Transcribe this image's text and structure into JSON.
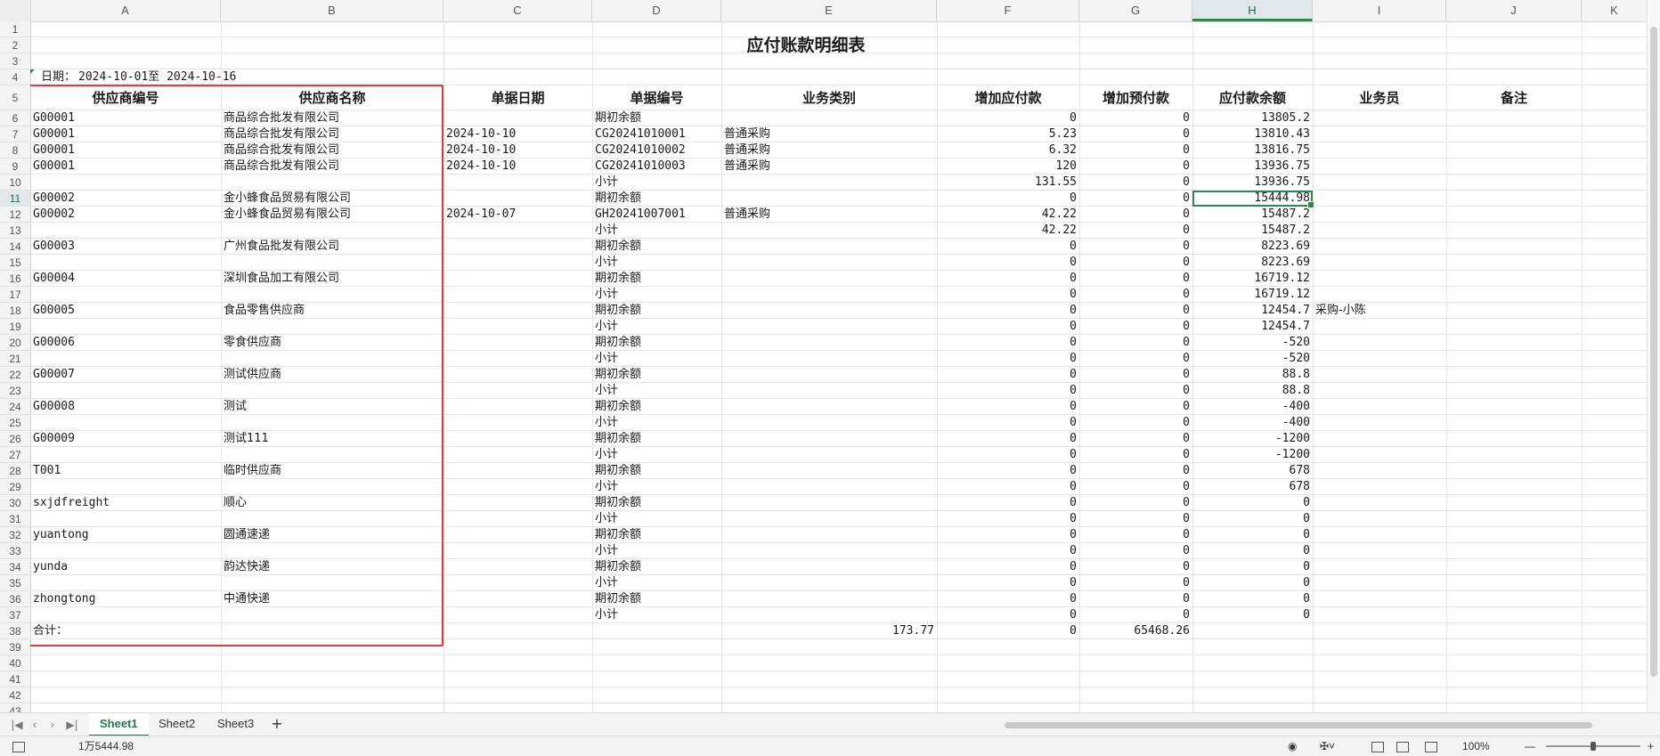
{
  "columns": [
    "A",
    "B",
    "C",
    "D",
    "E",
    "F",
    "G",
    "H",
    "I",
    "J",
    "K"
  ],
  "selected_column": "H",
  "selected_row": 11,
  "rows_count": 43,
  "title": "应付账款明细表",
  "date_label": "日期：",
  "date_range": "2024-10-01至 2024-10-16",
  "headers": [
    "供应商编号",
    "供应商名称",
    "单据日期",
    "单据编号",
    "业务类别",
    "增加应付款",
    "增加预付款",
    "应付款余额",
    "业务员",
    "备注"
  ],
  "table_rows": [
    {
      "row": 6,
      "A": "G00001",
      "B": "商品综合批发有限公司",
      "C": "",
      "D": "期初余额",
      "E": "",
      "F": "0",
      "G": "0",
      "H": "13805.2",
      "I": ""
    },
    {
      "row": 7,
      "A": "G00001",
      "B": "商品综合批发有限公司",
      "C": "2024-10-10",
      "D": "CG20241010001",
      "E": "普通采购",
      "F": "5.23",
      "G": "0",
      "H": "13810.43",
      "I": ""
    },
    {
      "row": 8,
      "A": "G00001",
      "B": "商品综合批发有限公司",
      "C": "2024-10-10",
      "D": "CG20241010002",
      "E": "普通采购",
      "F": "6.32",
      "G": "0",
      "H": "13816.75",
      "I": ""
    },
    {
      "row": 9,
      "A": "G00001",
      "B": "商品综合批发有限公司",
      "C": "2024-10-10",
      "D": "CG20241010003",
      "E": "普通采购",
      "F": "120",
      "G": "0",
      "H": "13936.75",
      "I": ""
    },
    {
      "row": 10,
      "A": "",
      "B": "",
      "C": "",
      "D": "小计",
      "E": "",
      "F": "131.55",
      "G": "0",
      "H": "13936.75",
      "I": ""
    },
    {
      "row": 11,
      "A": "G00002",
      "B": "金小蜂食品贸易有限公司",
      "C": "",
      "D": "期初余额",
      "E": "",
      "F": "0",
      "G": "0",
      "H": "15444.98",
      "I": ""
    },
    {
      "row": 12,
      "A": "G00002",
      "B": "金小蜂食品贸易有限公司",
      "C": "2024-10-07",
      "D": "GH20241007001",
      "E": "普通采购",
      "F": "42.22",
      "G": "0",
      "H": "15487.2",
      "I": ""
    },
    {
      "row": 13,
      "A": "",
      "B": "",
      "C": "",
      "D": "小计",
      "E": "",
      "F": "42.22",
      "G": "0",
      "H": "15487.2",
      "I": ""
    },
    {
      "row": 14,
      "A": "G00003",
      "B": "广州食品批发有限公司",
      "C": "",
      "D": "期初余额",
      "E": "",
      "F": "0",
      "G": "0",
      "H": "8223.69",
      "I": ""
    },
    {
      "row": 15,
      "A": "",
      "B": "",
      "C": "",
      "D": "小计",
      "E": "",
      "F": "0",
      "G": "0",
      "H": "8223.69",
      "I": ""
    },
    {
      "row": 16,
      "A": "G00004",
      "B": "深圳食品加工有限公司",
      "C": "",
      "D": "期初余额",
      "E": "",
      "F": "0",
      "G": "0",
      "H": "16719.12",
      "I": ""
    },
    {
      "row": 17,
      "A": "",
      "B": "",
      "C": "",
      "D": "小计",
      "E": "",
      "F": "0",
      "G": "0",
      "H": "16719.12",
      "I": ""
    },
    {
      "row": 18,
      "A": "G00005",
      "B": "食品零售供应商",
      "C": "",
      "D": "期初余额",
      "E": "",
      "F": "0",
      "G": "0",
      "H": "12454.7",
      "I": "采购-小陈"
    },
    {
      "row": 19,
      "A": "",
      "B": "",
      "C": "",
      "D": "小计",
      "E": "",
      "F": "0",
      "G": "0",
      "H": "12454.7",
      "I": ""
    },
    {
      "row": 20,
      "A": "G00006",
      "B": "零食供应商",
      "C": "",
      "D": "期初余额",
      "E": "",
      "F": "0",
      "G": "0",
      "H": "-520",
      "I": ""
    },
    {
      "row": 21,
      "A": "",
      "B": "",
      "C": "",
      "D": "小计",
      "E": "",
      "F": "0",
      "G": "0",
      "H": "-520",
      "I": ""
    },
    {
      "row": 22,
      "A": "G00007",
      "B": "测试供应商",
      "C": "",
      "D": "期初余额",
      "E": "",
      "F": "0",
      "G": "0",
      "H": "88.8",
      "I": ""
    },
    {
      "row": 23,
      "A": "",
      "B": "",
      "C": "",
      "D": "小计",
      "E": "",
      "F": "0",
      "G": "0",
      "H": "88.8",
      "I": ""
    },
    {
      "row": 24,
      "A": "G00008",
      "B": "测试",
      "C": "",
      "D": "期初余额",
      "E": "",
      "F": "0",
      "G": "0",
      "H": "-400",
      "I": ""
    },
    {
      "row": 25,
      "A": "",
      "B": "",
      "C": "",
      "D": "小计",
      "E": "",
      "F": "0",
      "G": "0",
      "H": "-400",
      "I": ""
    },
    {
      "row": 26,
      "A": "G00009",
      "B": "测试111",
      "C": "",
      "D": "期初余额",
      "E": "",
      "F": "0",
      "G": "0",
      "H": "-1200",
      "I": ""
    },
    {
      "row": 27,
      "A": "",
      "B": "",
      "C": "",
      "D": "小计",
      "E": "",
      "F": "0",
      "G": "0",
      "H": "-1200",
      "I": ""
    },
    {
      "row": 28,
      "A": "T001",
      "B": "临时供应商",
      "C": "",
      "D": "期初余额",
      "E": "",
      "F": "0",
      "G": "0",
      "H": "678",
      "I": ""
    },
    {
      "row": 29,
      "A": "",
      "B": "",
      "C": "",
      "D": "小计",
      "E": "",
      "F": "0",
      "G": "0",
      "H": "678",
      "I": ""
    },
    {
      "row": 30,
      "A": "sxjdfreight",
      "B": "顺心",
      "C": "",
      "D": "期初余额",
      "E": "",
      "F": "0",
      "G": "0",
      "H": "0",
      "I": ""
    },
    {
      "row": 31,
      "A": "",
      "B": "",
      "C": "",
      "D": "小计",
      "E": "",
      "F": "0",
      "G": "0",
      "H": "0",
      "I": ""
    },
    {
      "row": 32,
      "A": "yuantong",
      "B": "圆通速递",
      "C": "",
      "D": "期初余额",
      "E": "",
      "F": "0",
      "G": "0",
      "H": "0",
      "I": ""
    },
    {
      "row": 33,
      "A": "",
      "B": "",
      "C": "",
      "D": "小计",
      "E": "",
      "F": "0",
      "G": "0",
      "H": "0",
      "I": ""
    },
    {
      "row": 34,
      "A": "yunda",
      "B": "韵达快递",
      "C": "",
      "D": "期初余额",
      "E": "",
      "F": "0",
      "G": "0",
      "H": "0",
      "I": ""
    },
    {
      "row": 35,
      "A": "",
      "B": "",
      "C": "",
      "D": "小计",
      "E": "",
      "F": "0",
      "G": "0",
      "H": "0",
      "I": ""
    },
    {
      "row": 36,
      "A": "zhongtong",
      "B": "中通快递",
      "C": "",
      "D": "期初余额",
      "E": "",
      "F": "0",
      "G": "0",
      "H": "0",
      "I": ""
    },
    {
      "row": 37,
      "A": "",
      "B": "",
      "C": "",
      "D": "小计",
      "E": "",
      "F": "0",
      "G": "0",
      "H": "0",
      "I": ""
    }
  ],
  "total_row": {
    "row": 38,
    "A": "合计：",
    "E": "173.77",
    "F": "0",
    "G": "65468.26"
  },
  "sheet_tabs": [
    "Sheet1",
    "Sheet2",
    "Sheet3"
  ],
  "active_tab": "Sheet1",
  "add_tab_label": "+",
  "status": {
    "selection_value": "1万5444.98",
    "zoom": "100%",
    "zoom_minus": "—",
    "zoom_plus": "+"
  },
  "colors": {
    "selection": "#2a8a4a",
    "highlight_box": "#e23a3a",
    "active_tab": "#1f7a46"
  }
}
